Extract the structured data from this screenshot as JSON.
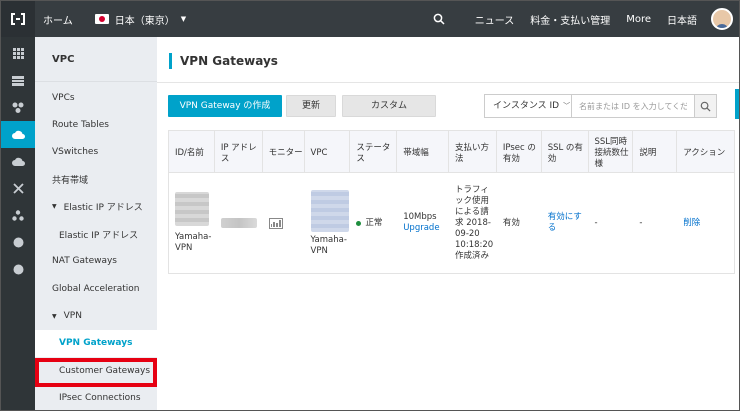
{
  "topbar": {
    "home": "ホーム",
    "region": "日本（東京）",
    "news": "ニュース",
    "billing": "料金・支払い管理",
    "more": "More",
    "language": "日本語"
  },
  "sidebar": {
    "title": "VPC",
    "items": [
      {
        "label": "VPCs"
      },
      {
        "label": "Route Tables"
      },
      {
        "label": "VSwitches"
      },
      {
        "label": "共有帯域"
      },
      {
        "label": "Elastic IP アドレス"
      },
      {
        "label": "Elastic IP アドレス"
      },
      {
        "label": "NAT Gateways"
      },
      {
        "label": "Global Acceleration"
      },
      {
        "label": "VPN"
      },
      {
        "label": "VPN Gateways"
      },
      {
        "label": "Customer Gateways"
      },
      {
        "label": "IPsec Connections"
      }
    ]
  },
  "main": {
    "title": "VPN Gateways",
    "create_button": "VPN Gateway の作成",
    "refresh_button": "更新",
    "custom_button": "カスタム",
    "search_select": "インスタンス ID",
    "search_placeholder": "名前または ID を入力してください"
  },
  "table": {
    "headers": [
      "ID/名前",
      "IP アドレス",
      "モニター",
      "VPC",
      "ステータス",
      "帯域幅",
      "支払い方法",
      "IPsec の有効",
      "SSL の有効",
      "SSL同時接続数仕様",
      "説明",
      "アクション"
    ],
    "row": {
      "name": "Yamaha-VPN",
      "vpc": "Yamaha-VPN",
      "status": "正常",
      "bandwidth": "10Mbps",
      "upgrade": "Upgrade",
      "payment": "トラフィック使用による請求 2018-09-20 10:18:20 作成済み",
      "ipsec": "有効",
      "ssl": "有効にする",
      "ssl_conn": "-",
      "description": "-",
      "action": "削除"
    }
  },
  "colors": {
    "accent": "#00a2ca",
    "topbar": "#373d41",
    "highlight": "#e60012",
    "status_ok": "#1e8e3e",
    "link": "#0070cc"
  }
}
